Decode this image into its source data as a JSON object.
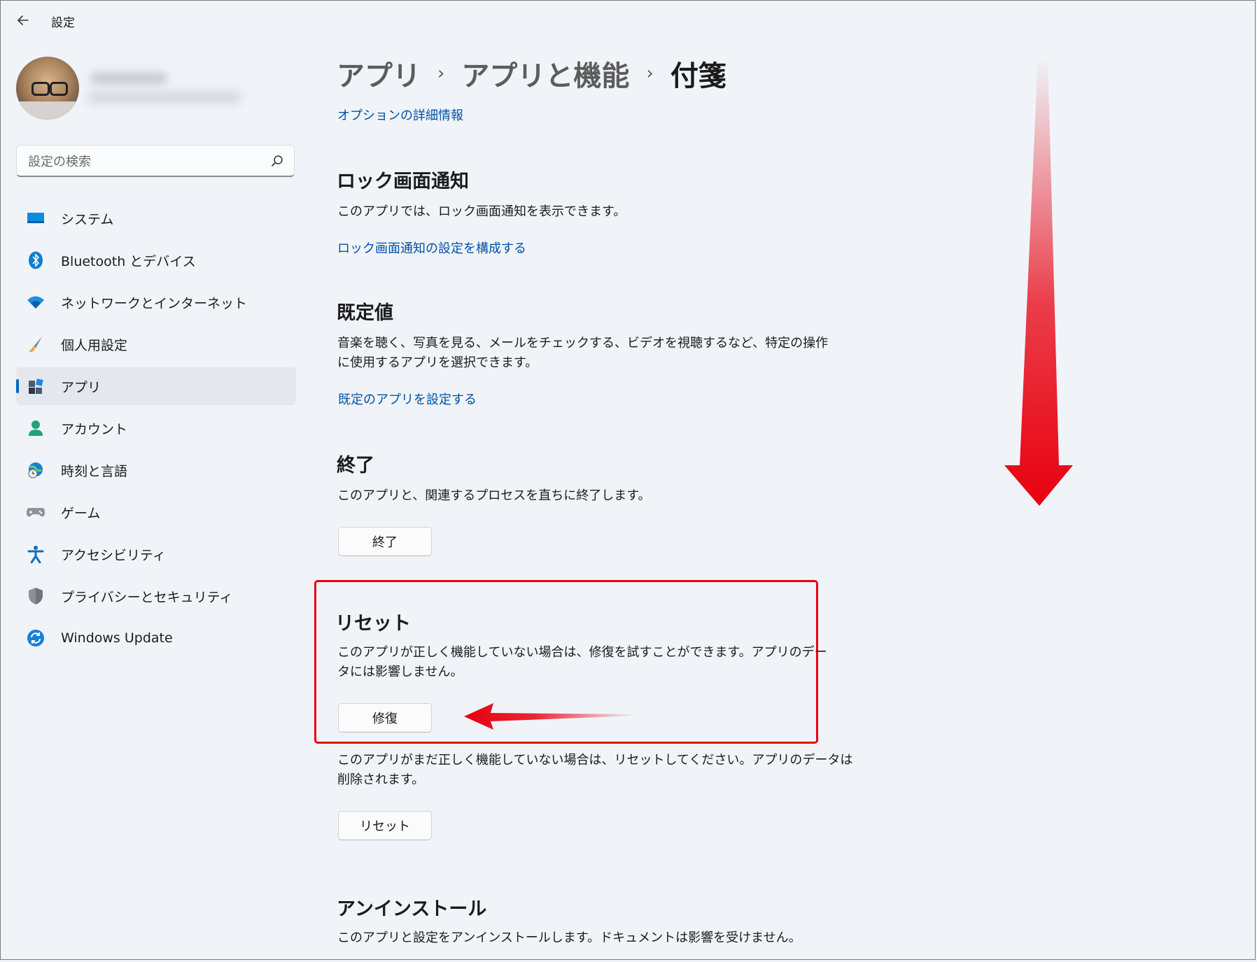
{
  "window": {
    "title": "設定"
  },
  "search": {
    "placeholder": "設定の検索"
  },
  "sidebar": {
    "items": [
      {
        "label": "システム",
        "icon": "system-icon"
      },
      {
        "label": "Bluetooth とデバイス",
        "icon": "bluetooth-icon"
      },
      {
        "label": "ネットワークとインターネット",
        "icon": "wifi-icon"
      },
      {
        "label": "個人用設定",
        "icon": "brush-icon"
      },
      {
        "label": "アプリ",
        "icon": "apps-icon",
        "selected": true
      },
      {
        "label": "アカウント",
        "icon": "account-icon"
      },
      {
        "label": "時刻と言語",
        "icon": "globe-clock-icon"
      },
      {
        "label": "ゲーム",
        "icon": "gamepad-icon"
      },
      {
        "label": "アクセシビリティ",
        "icon": "accessibility-icon"
      },
      {
        "label": "プライバシーとセキュリティ",
        "icon": "shield-icon"
      },
      {
        "label": "Windows Update",
        "icon": "update-icon"
      }
    ]
  },
  "breadcrumb": {
    "level1": "アプリ",
    "level2": "アプリと機能",
    "current": "付箋",
    "separator": "›"
  },
  "main": {
    "options_link": "オプションの詳細情報",
    "lock_screen": {
      "title": "ロック画面通知",
      "description": "このアプリでは、ロック画面通知を表示できます。",
      "link": "ロック画面通知の設定を構成する"
    },
    "defaults": {
      "title": "既定値",
      "description_line1": "音楽を聴く、写真を見る、メールをチェックする、ビデオを視聴するなど、特定の操作",
      "description_line2": "に使用するアプリを選択できます。",
      "link": "既定のアプリを設定する"
    },
    "terminate": {
      "title": "終了",
      "description": "このアプリと、関連するプロセスを直ちに終了します。",
      "button": "終了"
    },
    "reset": {
      "title": "リセット",
      "repair_description_line1": "このアプリが正しく機能していない場合は、修復を試すことができます。アプリのデー",
      "repair_description_line2": "タには影響しません。",
      "repair_button": "修復",
      "reset_description_line1": "このアプリがまだ正しく機能していない場合は、リセットしてください。アプリのデータは",
      "reset_description_line2": "削除されます。",
      "reset_button": "リセット"
    },
    "uninstall": {
      "title": "アンインストール",
      "description": "このアプリと設定をアンインストールします。ドキュメントは影響を受けません。"
    }
  },
  "colors": {
    "accent": "#0067c0",
    "link": "#0050a8",
    "annotation_red": "#e8000f",
    "background": "#f0f4f9"
  }
}
